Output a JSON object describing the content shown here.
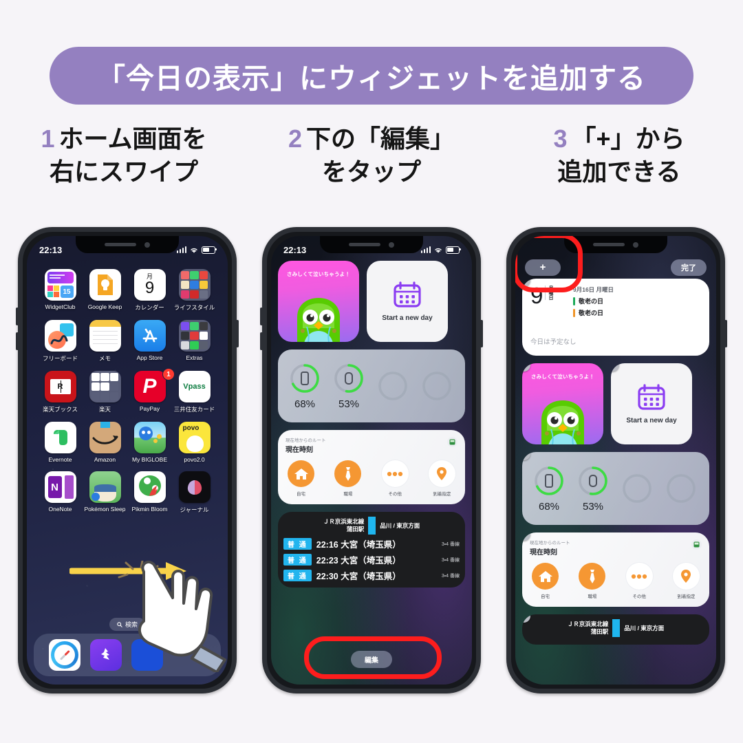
{
  "header": {
    "title": "「今日の表示」にウィジェットを追加する",
    "pill_color": "#9480c0"
  },
  "steps": [
    {
      "number": "1",
      "line1": "ホーム画面を",
      "line2": "右にスワイプ"
    },
    {
      "number": "2",
      "line1": "下の「編集」",
      "line2": "をタップ"
    },
    {
      "number": "3",
      "line1": "「+」から",
      "line2": "追加できる"
    }
  ],
  "phone1": {
    "status": {
      "time": "22:13"
    },
    "apps": [
      {
        "label": "WidgetClub"
      },
      {
        "label": "Google Keep"
      },
      {
        "label": "カレンダー",
        "day": "9",
        "weekday": "月"
      },
      {
        "label": "ライフスタイル"
      },
      {
        "label": "フリーボード"
      },
      {
        "label": "メモ"
      },
      {
        "label": "App Store"
      },
      {
        "label": "Extras"
      },
      {
        "label": "楽天ブックス"
      },
      {
        "label": "楽天"
      },
      {
        "label": "PayPay",
        "badge": "1"
      },
      {
        "label": "三井住友カード",
        "text": "Vpass"
      },
      {
        "label": "Evernote"
      },
      {
        "label": "Amazon"
      },
      {
        "label": "My BIGLOBE"
      },
      {
        "label": "povo2.0",
        "text": "povo"
      },
      {
        "label": "OneNote",
        "text": "N"
      },
      {
        "label": "Pokémon Sleep"
      },
      {
        "label": "Pikmin Bloom"
      },
      {
        "label": "ジャーナル"
      }
    ],
    "search": "検索",
    "dock": [
      {
        "label": "Safari"
      },
      {
        "label": "WidgetClub Shortcut"
      },
      {
        "label": "Blue App"
      }
    ],
    "gesture": {
      "arrow": "swipe-right-arrow",
      "hand": "hand-cursor"
    }
  },
  "phone2": {
    "status": {
      "time": "22:13"
    },
    "widgets": {
      "duolingo": {
        "caption": "さみしくて泣いちゃうよ！"
      },
      "newday": {
        "label": "Start a new day"
      },
      "battery": {
        "items": [
          {
            "device": "iphone",
            "pct": "68%",
            "value": 68
          },
          {
            "device": "watch",
            "pct": "53%",
            "value": 53
          }
        ],
        "empty_slots": 2
      },
      "route": {
        "subtitle": "現在地からのルート",
        "title": "現在時刻",
        "buttons": [
          {
            "label": "自宅",
            "icon": "home-icon"
          },
          {
            "label": "職場",
            "icon": "necktie-icon"
          },
          {
            "label": "その他",
            "icon": "ellipsis-icon"
          },
          {
            "label": "到着指定",
            "icon": "pin-icon"
          }
        ]
      },
      "train": {
        "line": "ＪＲ京浜東北線",
        "station": "蒲田駅",
        "direction": "品川 / 東京方面",
        "departures": [
          {
            "kind": "普 通",
            "time": "22:16",
            "dest": "大宮（埼玉県）",
            "platform": "3・4 番線"
          },
          {
            "kind": "普 通",
            "time": "22:23",
            "dest": "大宮（埼玉県）",
            "platform": "3・4 番線"
          },
          {
            "kind": "普 通",
            "time": "22:30",
            "dest": "大宮（埼玉県）",
            "platform": "3・4 番線"
          }
        ]
      }
    },
    "edit_button": "編集",
    "highlight_color": "#fd1d1d"
  },
  "phone3": {
    "nav": {
      "add": "+",
      "done": "完了"
    },
    "calendar": {
      "day": "9",
      "weekday_vertical": "月曜日",
      "date": "9月16日 月曜日",
      "events": [
        {
          "name": "敬老の日",
          "color": "#1eaa5a"
        },
        {
          "name": "敬老の日",
          "color": "#f0952a"
        }
      ],
      "no_events": "今日は予定なし"
    },
    "widgets": {
      "duolingo": {
        "caption": "さみしくて泣いちゃうよ！"
      },
      "newday": {
        "label": "Start a new day"
      },
      "battery": {
        "items": [
          {
            "device": "iphone",
            "pct": "68%",
            "value": 68
          },
          {
            "device": "watch",
            "pct": "53%",
            "value": 53
          }
        ],
        "empty_slots": 2
      },
      "route": {
        "subtitle": "現在地からのルート",
        "title": "現在時刻",
        "buttons": [
          {
            "label": "自宅",
            "icon": "home-icon"
          },
          {
            "label": "職場",
            "icon": "necktie-icon"
          },
          {
            "label": "その他",
            "icon": "ellipsis-icon"
          },
          {
            "label": "到着指定",
            "icon": "pin-icon"
          }
        ]
      },
      "train": {
        "line": "ＪＲ京浜東北線",
        "station": "蒲田駅",
        "direction": "品川 / 東京方面"
      }
    },
    "highlight_color": "#fd1d1d"
  }
}
